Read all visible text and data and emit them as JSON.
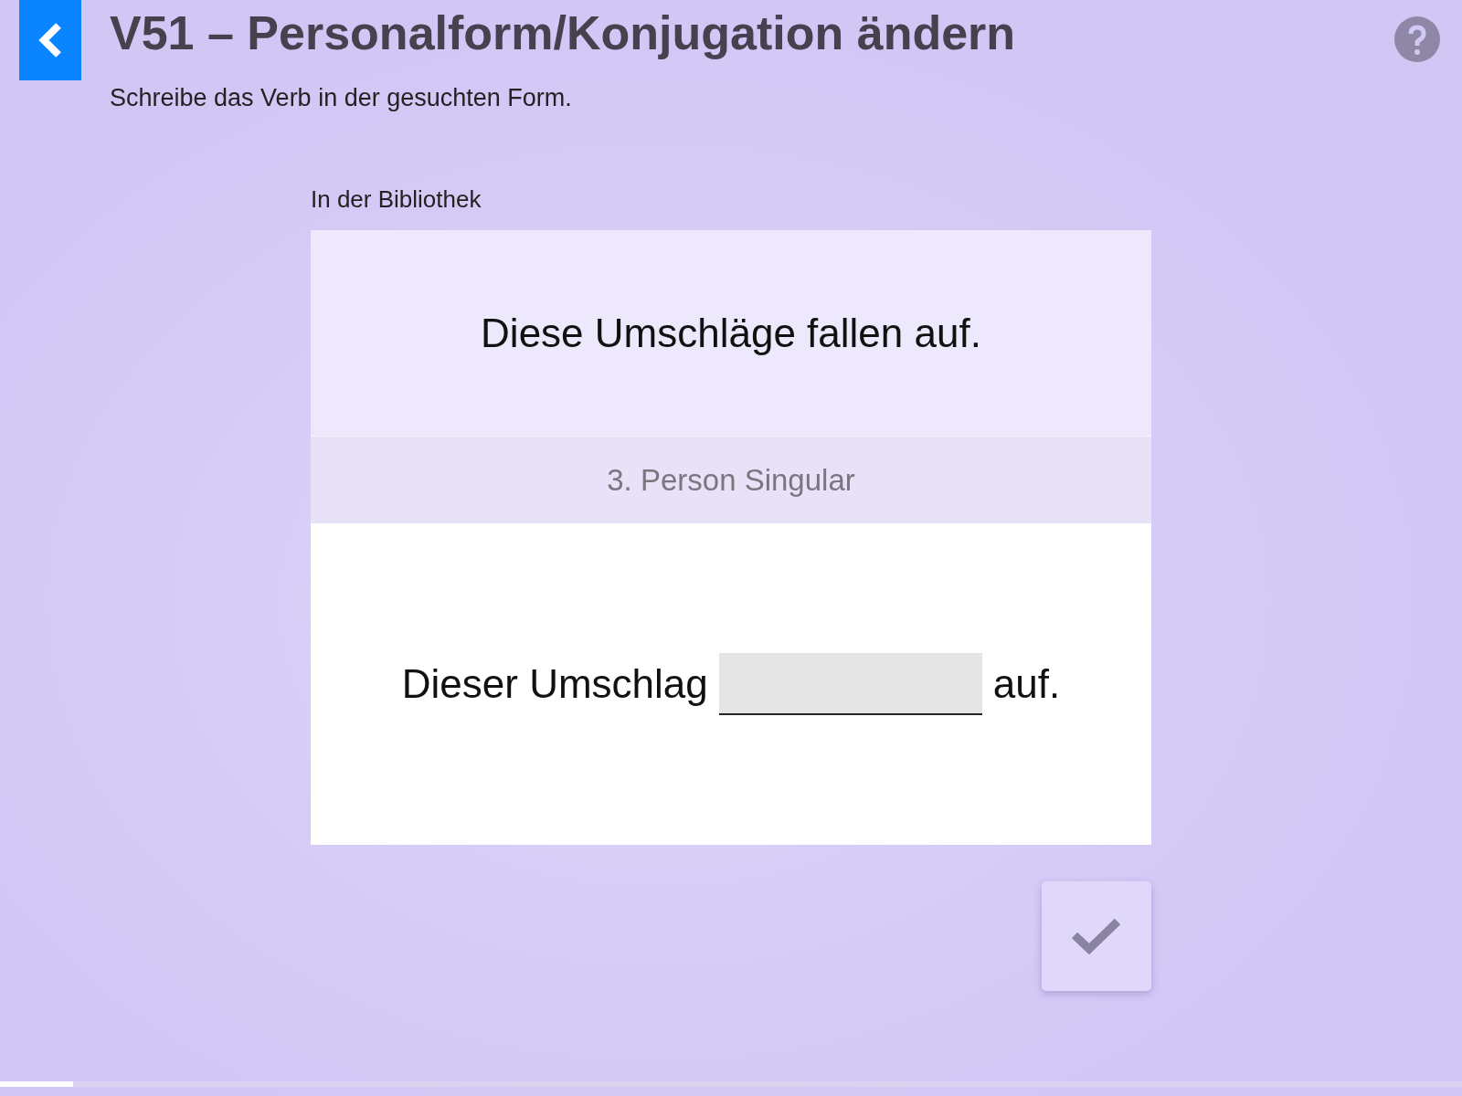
{
  "header": {
    "title": "V51 – Personalform/Konjugation ändern",
    "instruction": "Schreibe das Verb in der gesuchten Form."
  },
  "task": {
    "context": "In der Bibliothek",
    "sentence": "Diese Umschläge fallen auf.",
    "target_form": "3. Person Singular",
    "answer_before": "Dieser Umschlag",
    "answer_after": "auf."
  },
  "progress": {
    "level": 0.05
  }
}
